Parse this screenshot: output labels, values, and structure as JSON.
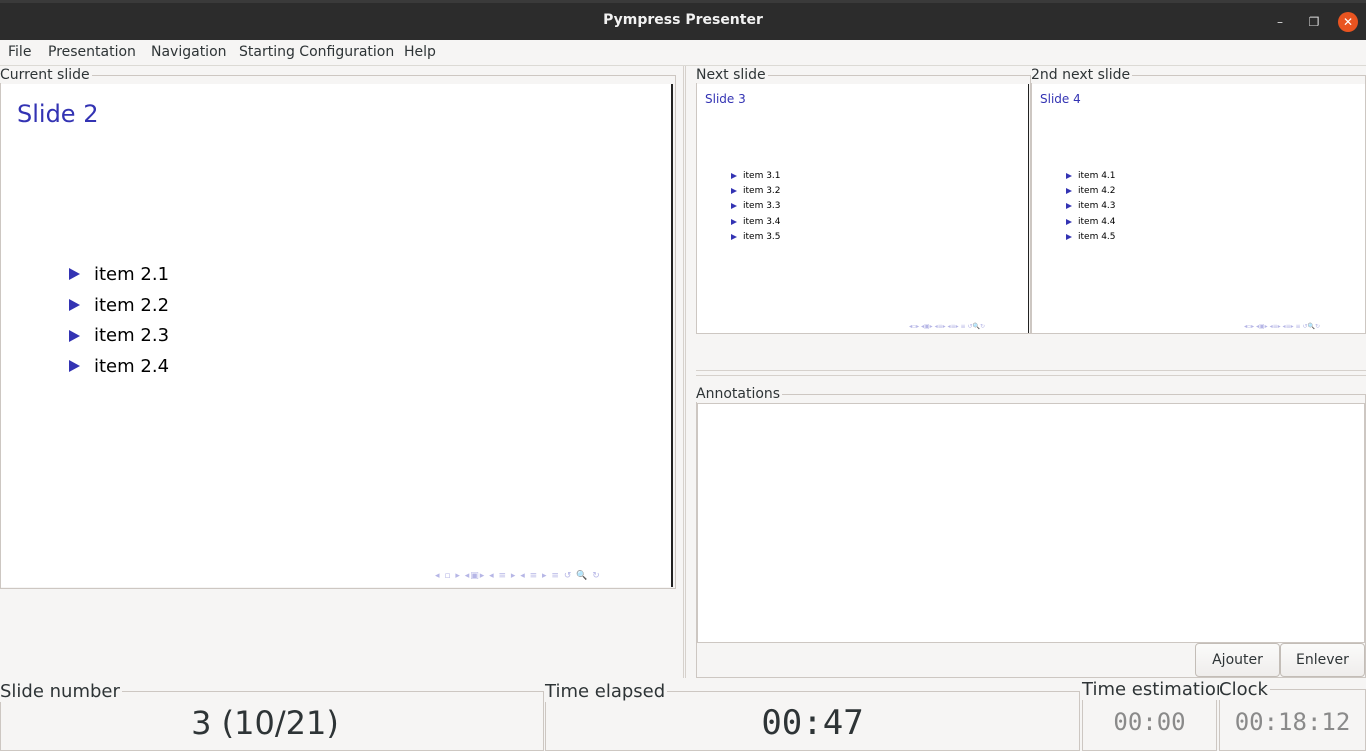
{
  "window": {
    "title": "Pympress Presenter",
    "minimize_glyph": "–",
    "maximize_glyph": "❐",
    "close_glyph": "✕"
  },
  "menu": [
    "File",
    "Presentation",
    "Navigation",
    "Starting Configuration",
    "Help"
  ],
  "current_slide": {
    "label": "Current slide",
    "title": "Slide 2",
    "items": [
      "item 2.1",
      "item 2.2",
      "item 2.3",
      "item 2.4"
    ],
    "nav_symbols": "◂ ▫ ▸  ◂▣▸  ◂ ≡ ▸  ◂ ≡ ▸   ≡   ↺ 🔍 ↻"
  },
  "next_slide": {
    "label": "Next slide",
    "title": "Slide 3",
    "items": [
      "item 3.1",
      "item 3.2",
      "item 3.3",
      "item 3.4",
      "item 3.5"
    ],
    "nav_symbols": "◂▫▸ ◂▣▸ ◂≡▸ ◂≡▸ ≡ ↺🔍↻"
  },
  "second_next_slide": {
    "label": "2nd next slide",
    "title": "Slide 4",
    "items": [
      "item 4.1",
      "item 4.2",
      "item 4.3",
      "item 4.4",
      "item 4.5"
    ],
    "nav_symbols": "◂▫▸ ◂▣▸ ◂≡▸ ◂≡▸ ≡ ↺🔍↻"
  },
  "annotations": {
    "label": "Annotations",
    "add_button": "Ajouter",
    "remove_button": "Enlever"
  },
  "status": {
    "slide_number_label": "Slide number",
    "slide_number_value": "3 (10/21)",
    "time_elapsed_label": "Time elapsed",
    "time_elapsed_value": "00:47",
    "time_estimation_label": "Time estimation",
    "time_estimation_value": "00:00",
    "clock_label": "Clock",
    "clock_value": "00:18:12"
  },
  "colors": {
    "slide_accent": "#3333b3",
    "close_button": "#e95420"
  }
}
